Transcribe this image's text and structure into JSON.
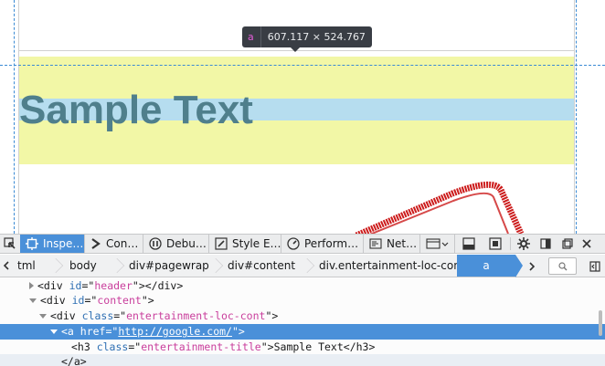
{
  "tooltip": {
    "tag": "a",
    "dimensions": "607.117 × 524.767"
  },
  "page": {
    "sample_text": "Sample Text"
  },
  "toolbar": {
    "tabs": [
      {
        "label": "Inspe…",
        "icon": "inspector-icon",
        "active": true
      },
      {
        "label": "Con…",
        "icon": "console-icon",
        "active": false
      },
      {
        "label": "Debu…",
        "icon": "debugger-icon",
        "active": false
      },
      {
        "label": "Style E…",
        "icon": "style-editor-icon",
        "active": false
      },
      {
        "label": "Perform…",
        "icon": "performance-icon",
        "active": false
      },
      {
        "label": "Net…",
        "icon": "network-icon",
        "active": false
      }
    ]
  },
  "breadcrumb": {
    "items": [
      "tml",
      "body",
      "div#pagewrap",
      "div#content",
      "div.entertainment-loc-cont",
      "a"
    ]
  },
  "tree": {
    "row1": {
      "tag_open": "<div ",
      "attr": "id",
      "eq": "=\"",
      "val": "header",
      "tag_close": "\"></div>"
    },
    "row2": {
      "tag_open": "<div ",
      "attr": "id",
      "eq": "=\"",
      "val": "content",
      "tag_close": "\">"
    },
    "row3": {
      "tag_open": "<div ",
      "attr": "class",
      "eq": "=\"",
      "val": "entertainment-loc-cont",
      "tag_close": "\">"
    },
    "row4": {
      "tag_open": "<a ",
      "attr": "href",
      "eq": "=\"",
      "val": "http://google.com/",
      "tag_close": "\">"
    },
    "row5": {
      "tag_open": "<h3 ",
      "attr": "class",
      "eq": "=\"",
      "val": "entertainment-title",
      "tag_close": "\">",
      "text": "Sample Text",
      "end": "</h3>"
    },
    "row6": {
      "tag_open": "</a>"
    }
  },
  "colors": {
    "accent": "#4a90d9",
    "margin_highlight": "#f2f7a6",
    "content_highlight": "#b6ddef",
    "guide": "#3a8ad4",
    "stamp_red": "#cc1b1b"
  }
}
